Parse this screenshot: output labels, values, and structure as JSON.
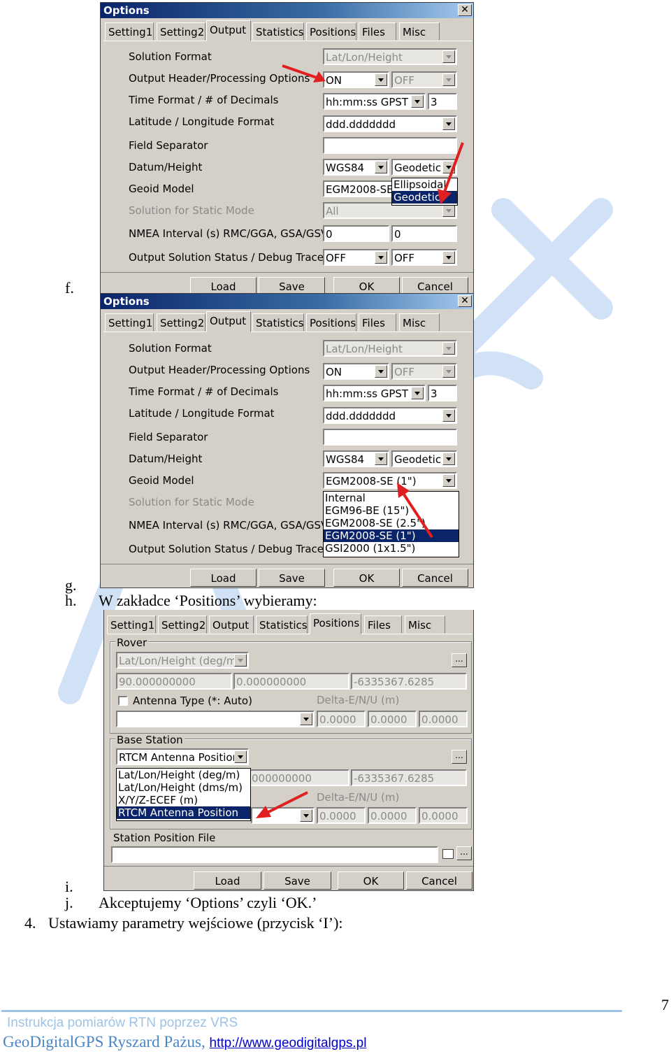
{
  "doc": {
    "f": "f.",
    "g": "g.",
    "h": "h.",
    "h_text": "W zakładce ‘Positions’ wybieramy:",
    "i": "i.",
    "j": "j.",
    "j_text": "Akceptujemy ‘Options’ czyli ‘OK.’",
    "item4": "4.",
    "item4_text": "Ustawiamy parametry wejściowe (przycisk ‘I’):",
    "page_number": "7"
  },
  "watermark_color": "#4a90e2",
  "dialog_common": {
    "title": "Options",
    "close": "✕",
    "tabs": [
      "Setting1",
      "Setting2",
      "Output",
      "Statistics",
      "Positions",
      "Files",
      "Misc"
    ],
    "buttons": {
      "load": "Load",
      "save": "Save",
      "ok": "OK",
      "cancel": "Cancel"
    }
  },
  "output_dialog": {
    "labels": {
      "solution_format": "Solution Format",
      "output_header": "Output Header/Processing Options",
      "time_format": "Time Format / # of Decimals",
      "latlon_format": "Latitude / Longitude Format",
      "field_separator": "Field Separator",
      "datum_height": "Datum/Height",
      "geoid_model": "Geoid Model",
      "static_mode": "Solution for Static Mode",
      "nmea_interval": "NMEA Interval (s) RMC/GGA, GSA/GSV",
      "output_status": "Output Solution Status / Debug Trace"
    },
    "values": {
      "solution_format": "Lat/Lon/Height",
      "output_header": "ON",
      "processing_options": "OFF",
      "time_format": "hh:mm:ss GPST",
      "decimals": "3",
      "latlon_format": "ddd.ddddddd",
      "field_separator": "",
      "datum": "WGS84",
      "height": "Geodetic",
      "static_mode": "All",
      "nmea_rmc": "0",
      "nmea_gsa": "0",
      "solution_status": "OFF",
      "debug_trace": "OFF"
    }
  },
  "dialog1": {
    "geoid_value": "EGM2008-SE (",
    "height_dropdown": [
      "Ellipsoidal",
      "Geodetic"
    ],
    "height_selected_index": 1
  },
  "dialog2": {
    "geoid_value": "EGM2008-SE (1\")",
    "geoid_dropdown": [
      "Internal",
      "EGM96-BE (15\")",
      "EGM2008-SE (2.5\")",
      "EGM2008-SE (1\")",
      "GSI2000 (1x1.5\")"
    ],
    "geoid_selected_index": 3
  },
  "positions_dialog": {
    "rover_label": "Rover",
    "rover_type": "Lat/Lon/Height (deg/m)",
    "rover_lat": "90.000000000",
    "rover_lon": "0.000000000",
    "rover_height": "-6335367.6285",
    "antenna_type_label": "Antenna Type (*: Auto)",
    "delta_label": "Delta-E/N/U (m)",
    "rover_antenna": "",
    "rover_de": "0.0000",
    "rover_dn": "0.0000",
    "rover_du": "0.0000",
    "base_label": "Base Station",
    "base_type": "RTCM Antenna Position",
    "base_dropdown": [
      "Lat/Lon/Height (deg/m)",
      "Lat/Lon/Height (dms/m)",
      "X/Y/Z-ECEF (m)",
      "RTCM Antenna Position"
    ],
    "base_selected_index": 3,
    "base_lon": "0.000000000",
    "base_lon_visible": "000000000",
    "base_height": "-6335367.6285",
    "base_de": "0.0000",
    "base_dn": "0.0000",
    "base_du": "0.0000",
    "station_file_label": "Station Position File",
    "station_file": "",
    "dots": "..."
  },
  "footer": {
    "line1": "Instrukcja pomiarów RTN poprzez VRS",
    "line2": "GeoDigitalGPS Ryszard Pażus, ",
    "url": "http://www.geodigitalgps.pl"
  },
  "arrow_color": "#e02020"
}
